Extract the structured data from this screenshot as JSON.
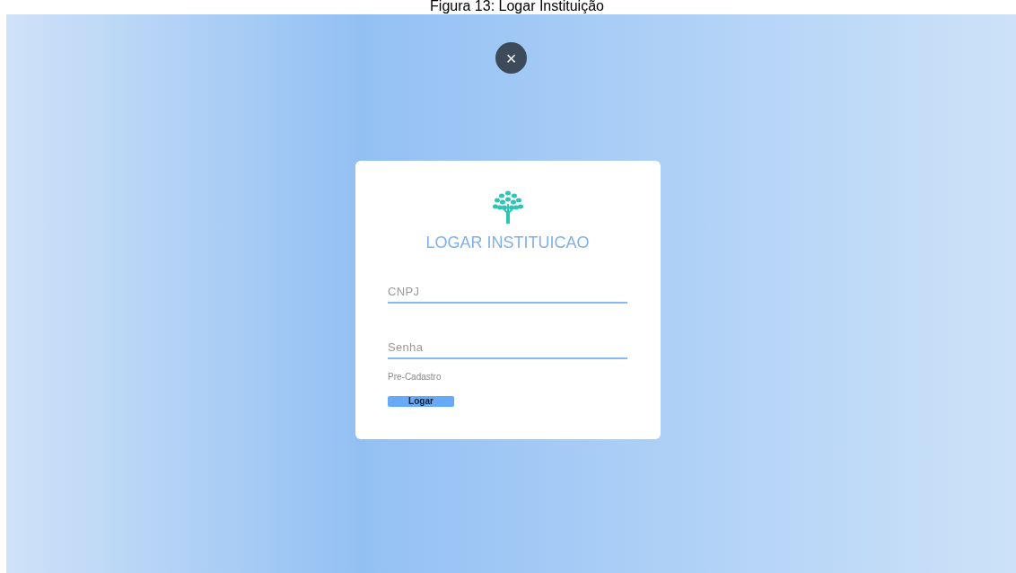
{
  "caption": "Figura 13: Logar Instituição",
  "close_button": {
    "label": "×"
  },
  "card": {
    "title": "LOGAR INSTITUICAO",
    "fields": [
      {
        "placeholder": "CNPJ"
      },
      {
        "placeholder": "Senha"
      }
    ],
    "link": "Pre-Cadastro",
    "button": "Logar"
  }
}
